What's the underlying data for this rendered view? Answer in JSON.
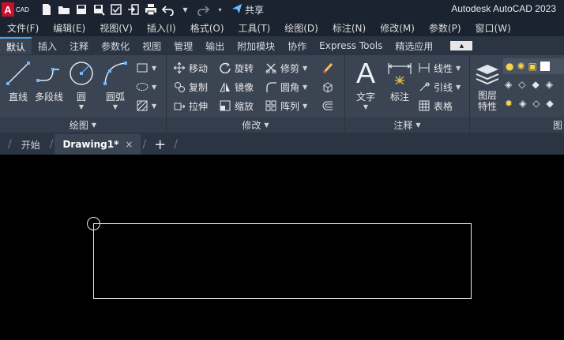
{
  "app": {
    "logo_letter": "A",
    "logo_sub": "CAD",
    "title": "Autodesk AutoCAD 2023",
    "share_label": "共享"
  },
  "quick_access": [
    "new-icon",
    "open-icon",
    "save-icon",
    "save-as-icon",
    "web-save-icon",
    "import-icon",
    "print-icon",
    "undo-icon",
    "redo-icon"
  ],
  "menu": [
    "文件(F)",
    "编辑(E)",
    "视图(V)",
    "插入(I)",
    "格式(O)",
    "工具(T)",
    "绘图(D)",
    "标注(N)",
    "修改(M)",
    "参数(P)",
    "窗口(W)"
  ],
  "ribbon_tabs": [
    "默认",
    "插入",
    "注释",
    "参数化",
    "视图",
    "管理",
    "输出",
    "附加模块",
    "协作",
    "Express Tools",
    "精选应用"
  ],
  "ribbon_active_tab": "默认",
  "panels": {
    "draw": {
      "title": "绘图",
      "line": "直线",
      "polyline": "多段线",
      "circle": "圆",
      "arc": "圆弧"
    },
    "modify": {
      "title": "修改",
      "move": "移动",
      "rotate": "旋转",
      "trim": "修剪",
      "copy": "复制",
      "mirror": "镜像",
      "fillet": "圆角",
      "stretch": "拉伸",
      "scale": "缩放",
      "array": "阵列"
    },
    "annotation": {
      "title": "注释",
      "text": "文字",
      "dimension": "标注",
      "linear": "线性",
      "leader": "引线",
      "table": "表格"
    },
    "layers": {
      "title": "图",
      "properties": "图层",
      "properties2": "特性"
    }
  },
  "file_tabs": {
    "start": "开始",
    "drawing": "Drawing1*",
    "close": "×",
    "new": "+"
  },
  "colors": {
    "accent": "#4ea0e6",
    "ribbon_bg": "#3b4453",
    "title_bg": "#1b2330"
  }
}
